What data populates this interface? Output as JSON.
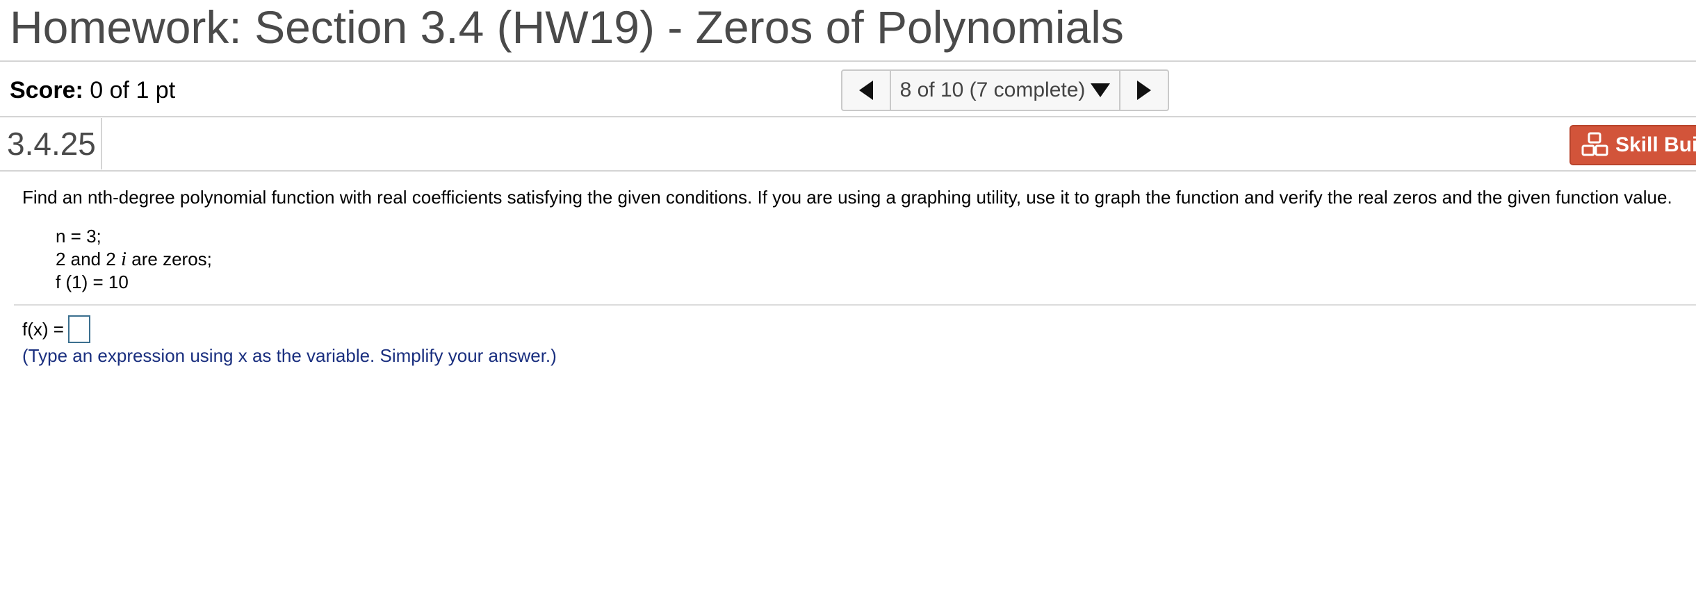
{
  "header": {
    "title": "Homework: Section 3.4 (HW19) - Zeros of Polynomials"
  },
  "score": {
    "label": "Score:",
    "value": "0 of 1 pt"
  },
  "navigation": {
    "position_text": "8 of 10 (7 complete)"
  },
  "question": {
    "number": "3.4.25",
    "skill_builder_label": "Skill Build",
    "instructions": "Find an nth-degree polynomial function with real coefficients satisfying the given conditions. If you are using a graphing utility, use it to graph the function and verify the real zeros and the given function value.",
    "conditions": {
      "n_line": "n = 3;",
      "zeros_prefix": "2 and 2",
      "zeros_var": "i",
      "zeros_suffix": "are zeros;",
      "value_line": "f (1) = 10"
    },
    "answer_label": "f(x) =",
    "answer_value": "",
    "hint": "(Type an expression using x as the variable. Simplify your answer.)"
  },
  "colors": {
    "skill_builder_bg": "#d2543a",
    "hint_text": "#1a2f7f",
    "title_text": "#4a4a4a"
  }
}
